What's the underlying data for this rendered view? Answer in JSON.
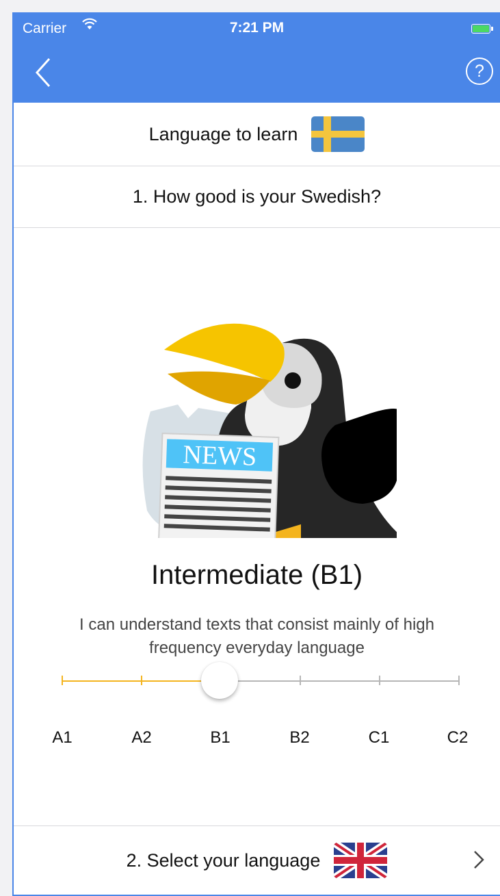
{
  "status_bar": {
    "carrier": "Carrier",
    "time": "7:21 PM"
  },
  "nav": {
    "back_icon": "chevron-left-icon",
    "help_icon": "question-circle-icon",
    "help_text": "?"
  },
  "language_to_learn": {
    "label": "Language to learn",
    "flag": "sweden-flag-icon"
  },
  "question": {
    "text": "1. How good is your Swedish?"
  },
  "illustration": {
    "name": "toucan-reading-newspaper",
    "newspaper_text": "NEWS"
  },
  "level": {
    "title": "Intermediate (B1)",
    "description": "I can understand texts that consist mainly of high frequency everyday language",
    "selected_index": 2
  },
  "slider": {
    "labels": [
      "A1",
      "A2",
      "B1",
      "B2",
      "C1",
      "C2"
    ]
  },
  "select_language": {
    "label": "2. Select your language",
    "flag": "uk-flag-icon",
    "chevron": "chevron-right-icon"
  },
  "colors": {
    "nav_bar": "#4a86e8",
    "slider_active": "#f4b41e",
    "slider_inactive": "#b6b6b6",
    "battery": "#4cd964"
  }
}
